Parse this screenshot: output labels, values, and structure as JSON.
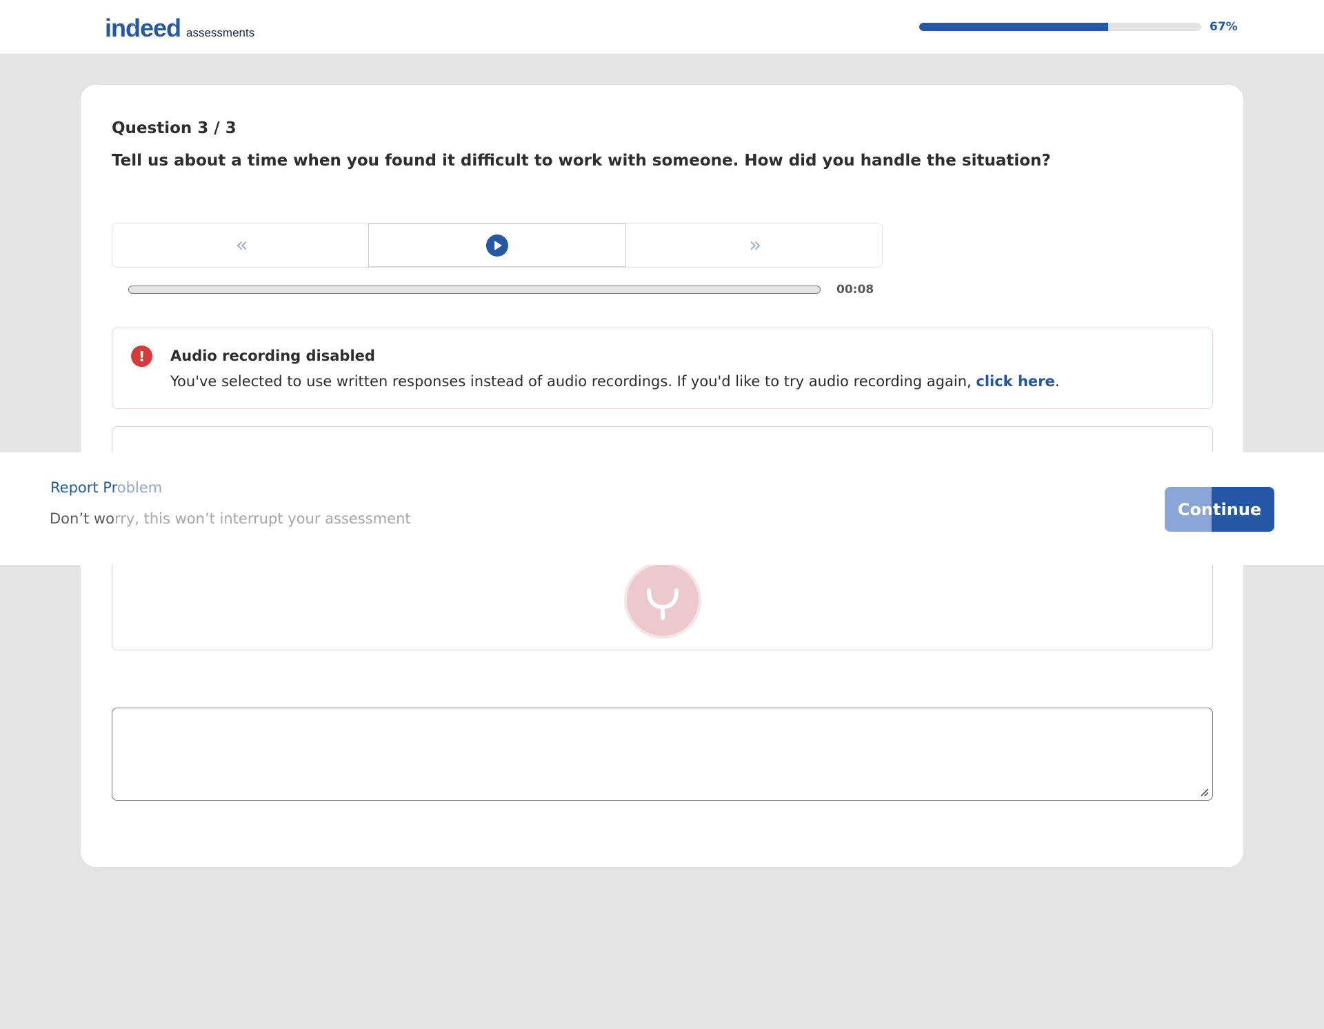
{
  "header": {
    "logo_main": "indeed",
    "logo_sub": "assessments",
    "progress_percent": 67,
    "progress_label": "67%"
  },
  "question": {
    "number_label": "Question 3 / 3",
    "text": "Tell us about a time when you found it difficult to work with someone. How did you handle the situation?"
  },
  "player": {
    "rewind_glyph": "«",
    "forward_glyph": "»",
    "time": "00:08"
  },
  "alert": {
    "title": "Audio recording disabled",
    "body": "You've selected to use written responses instead of audio recordings. If you'd like to try audio recording again,",
    "link": "click here",
    "after_link": "."
  },
  "answer": {
    "value": ""
  },
  "footer": {
    "report_part1": "Report Pr",
    "report_part2": "oblem",
    "note_part1": "Don’t wo",
    "note_part2": "rry, this won’t interrupt your assessment",
    "continue_label": "Continue"
  },
  "colors": {
    "brand": "#2557a7",
    "alert": "#d73a3a",
    "mic": "#ebc9cc"
  },
  "icons": [
    "rewind-icon",
    "play-icon",
    "forward-icon",
    "error-icon",
    "microphone-icon",
    "resize-grip-icon"
  ]
}
